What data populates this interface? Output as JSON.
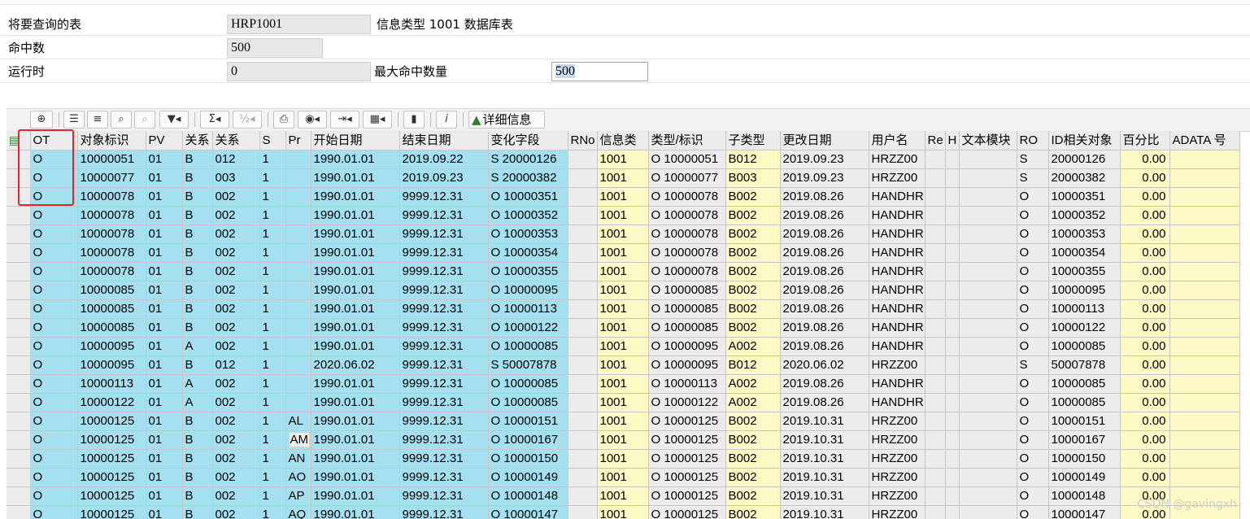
{
  "params": {
    "table_label": "将要查询的表",
    "table_value": "HRP1001",
    "table_desc": "信息类型 1001 数据库表",
    "hits_label": "命中数",
    "hits_value": "500",
    "runtime_label": "运行时",
    "runtime_value": "0",
    "max_hits_label": "最大命中数量",
    "max_hits_value": "500"
  },
  "toolbar": {
    "icons": [
      "select-row-icon",
      "sort-ascending-icon",
      "filter-icon",
      "find-icon",
      "find-next-icon",
      "set-filter-icon",
      "sum-icon",
      "subtotal-icon",
      "print-icon",
      "views-icon",
      "export-icon",
      "layout-icon",
      "chart-icon",
      "info-icon"
    ],
    "detail_label": "详细信息"
  },
  "columns": [
    "OT",
    "对象标识",
    "PV",
    "关系",
    "关系",
    "S",
    "Pr",
    "开始日期",
    "结束日期",
    "变化字段",
    "RNo",
    "信息类",
    "类型/标识",
    "子类型",
    "更改日期",
    "用户名",
    "Re",
    "H",
    "文本模块",
    "RO",
    "ID相关对象",
    "百分比",
    "ADATA 号"
  ],
  "rows": [
    [
      "O",
      "10000051",
      "01",
      "B",
      "012",
      "1",
      "",
      "1990.01.01",
      "2019.09.22",
      "S 20000126",
      "",
      "1001",
      "O 10000051",
      "B012",
      "2019.09.23",
      "HRZZ00",
      "",
      "",
      "",
      "S",
      "20000126",
      "0.00",
      ""
    ],
    [
      "O",
      "10000077",
      "01",
      "B",
      "003",
      "1",
      "",
      "1990.01.01",
      "2019.09.23",
      "S 20000382",
      "",
      "1001",
      "O 10000077",
      "B003",
      "2019.09.23",
      "HRZZ00",
      "",
      "",
      "",
      "S",
      "20000382",
      "0.00",
      ""
    ],
    [
      "O",
      "10000078",
      "01",
      "B",
      "002",
      "1",
      "",
      "1990.01.01",
      "9999.12.31",
      "O 10000351",
      "",
      "1001",
      "O 10000078",
      "B002",
      "2019.08.26",
      "HANDHR",
      "",
      "",
      "",
      "O",
      "10000351",
      "0.00",
      ""
    ],
    [
      "O",
      "10000078",
      "01",
      "B",
      "002",
      "1",
      "",
      "1990.01.01",
      "9999.12.31",
      "O 10000352",
      "",
      "1001",
      "O 10000078",
      "B002",
      "2019.08.26",
      "HANDHR",
      "",
      "",
      "",
      "O",
      "10000352",
      "0.00",
      ""
    ],
    [
      "O",
      "10000078",
      "01",
      "B",
      "002",
      "1",
      "",
      "1990.01.01",
      "9999.12.31",
      "O 10000353",
      "",
      "1001",
      "O 10000078",
      "B002",
      "2019.08.26",
      "HANDHR",
      "",
      "",
      "",
      "O",
      "10000353",
      "0.00",
      ""
    ],
    [
      "O",
      "10000078",
      "01",
      "B",
      "002",
      "1",
      "",
      "1990.01.01",
      "9999.12.31",
      "O 10000354",
      "",
      "1001",
      "O 10000078",
      "B002",
      "2019.08.26",
      "HANDHR",
      "",
      "",
      "",
      "O",
      "10000354",
      "0.00",
      ""
    ],
    [
      "O",
      "10000078",
      "01",
      "B",
      "002",
      "1",
      "",
      "1990.01.01",
      "9999.12.31",
      "O 10000355",
      "",
      "1001",
      "O 10000078",
      "B002",
      "2019.08.26",
      "HANDHR",
      "",
      "",
      "",
      "O",
      "10000355",
      "0.00",
      ""
    ],
    [
      "O",
      "10000085",
      "01",
      "B",
      "002",
      "1",
      "",
      "1990.01.01",
      "9999.12.31",
      "O 10000095",
      "",
      "1001",
      "O 10000085",
      "B002",
      "2019.08.26",
      "HANDHR",
      "",
      "",
      "",
      "O",
      "10000095",
      "0.00",
      ""
    ],
    [
      "O",
      "10000085",
      "01",
      "B",
      "002",
      "1",
      "",
      "1990.01.01",
      "9999.12.31",
      "O 10000113",
      "",
      "1001",
      "O 10000085",
      "B002",
      "2019.08.26",
      "HANDHR",
      "",
      "",
      "",
      "O",
      "10000113",
      "0.00",
      ""
    ],
    [
      "O",
      "10000085",
      "01",
      "B",
      "002",
      "1",
      "",
      "1990.01.01",
      "9999.12.31",
      "O 10000122",
      "",
      "1001",
      "O 10000085",
      "B002",
      "2019.08.26",
      "HANDHR",
      "",
      "",
      "",
      "O",
      "10000122",
      "0.00",
      ""
    ],
    [
      "O",
      "10000095",
      "01",
      "A",
      "002",
      "1",
      "",
      "1990.01.01",
      "9999.12.31",
      "O 10000085",
      "",
      "1001",
      "O 10000095",
      "A002",
      "2019.08.26",
      "HANDHR",
      "",
      "",
      "",
      "O",
      "10000085",
      "0.00",
      ""
    ],
    [
      "O",
      "10000095",
      "01",
      "B",
      "012",
      "1",
      "",
      "2020.06.02",
      "9999.12.31",
      "S 50007878",
      "",
      "1001",
      "O 10000095",
      "B012",
      "2020.06.02",
      "HRZZ00",
      "",
      "",
      "",
      "S",
      "50007878",
      "0.00",
      ""
    ],
    [
      "O",
      "10000113",
      "01",
      "A",
      "002",
      "1",
      "",
      "1990.01.01",
      "9999.12.31",
      "O 10000085",
      "",
      "1001",
      "O 10000113",
      "A002",
      "2019.08.26",
      "HANDHR",
      "",
      "",
      "",
      "O",
      "10000085",
      "0.00",
      ""
    ],
    [
      "O",
      "10000122",
      "01",
      "A",
      "002",
      "1",
      "",
      "1990.01.01",
      "9999.12.31",
      "O 10000085",
      "",
      "1001",
      "O 10000122",
      "A002",
      "2019.08.26",
      "HANDHR",
      "",
      "",
      "",
      "O",
      "10000085",
      "0.00",
      ""
    ],
    [
      "O",
      "10000125",
      "01",
      "B",
      "002",
      "1",
      "AL",
      "1990.01.01",
      "9999.12.31",
      "O 10000151",
      "",
      "1001",
      "O 10000125",
      "B002",
      "2019.10.31",
      "HRZZ00",
      "",
      "",
      "",
      "O",
      "10000151",
      "0.00",
      ""
    ],
    [
      "O",
      "10000125",
      "01",
      "B",
      "002",
      "1",
      "AM",
      "1990.01.01",
      "9999.12.31",
      "O 10000167",
      "",
      "1001",
      "O 10000125",
      "B002",
      "2019.10.31",
      "HRZZ00",
      "",
      "",
      "",
      "O",
      "10000167",
      "0.00",
      ""
    ],
    [
      "O",
      "10000125",
      "01",
      "B",
      "002",
      "1",
      "AN",
      "1990.01.01",
      "9999.12.31",
      "O 10000150",
      "",
      "1001",
      "O 10000125",
      "B002",
      "2019.10.31",
      "HRZZ00",
      "",
      "",
      "",
      "O",
      "10000150",
      "0.00",
      ""
    ],
    [
      "O",
      "10000125",
      "01",
      "B",
      "002",
      "1",
      "AO",
      "1990.01.01",
      "9999.12.31",
      "O 10000149",
      "",
      "1001",
      "O 10000125",
      "B002",
      "2019.10.31",
      "HRZZ00",
      "",
      "",
      "",
      "O",
      "10000149",
      "0.00",
      ""
    ],
    [
      "O",
      "10000125",
      "01",
      "B",
      "002",
      "1",
      "AP",
      "1990.01.01",
      "9999.12.31",
      "O 10000148",
      "",
      "1001",
      "O 10000125",
      "B002",
      "2019.10.31",
      "HRZZ00",
      "",
      "",
      "",
      "O",
      "10000148",
      "0.00",
      ""
    ],
    [
      "O",
      "10000125",
      "01",
      "B",
      "002",
      "1",
      "AQ",
      "1990.01.01",
      "9999.12.31",
      "O 10000147",
      "",
      "1001",
      "O 10000125",
      "B002",
      "2019.10.31",
      "HRZZ00",
      "",
      "",
      "",
      "O",
      "10000147",
      "0.00",
      ""
    ]
  ],
  "colors": {
    "key_column": "#a5e0f0",
    "info_column": "#fcf9c4",
    "highlight_box": "#e8242b"
  },
  "watermark": "CSDN @gavingxh"
}
